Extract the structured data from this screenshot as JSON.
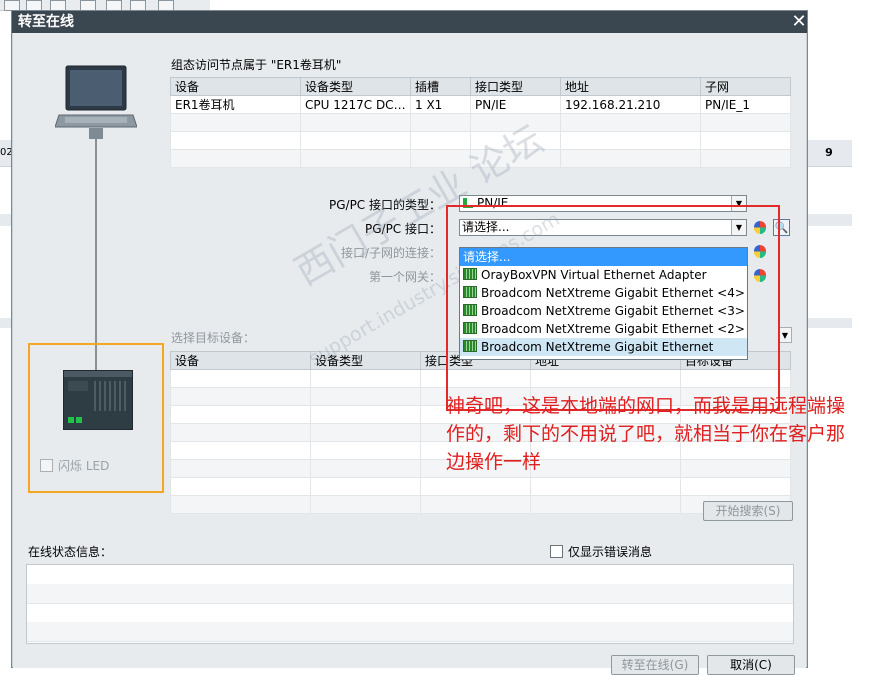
{
  "dialog": {
    "title": "转至在线",
    "close_label": "✕"
  },
  "background": {
    "cell_value": "9",
    "left_cell_value": "02"
  },
  "group_info": "组态访问节点属于 \"ER1卷耳机\"",
  "device_table": {
    "headers": [
      "设备",
      "设备类型",
      "插槽",
      "接口类型",
      "地址",
      "子网"
    ],
    "rows": [
      [
        "ER1卷耳机",
        "CPU 1217C DC/D...",
        "1 X1",
        "PN/IE",
        "192.168.21.210",
        "PN/IE_1"
      ]
    ]
  },
  "form": {
    "pgpc_type_label": "PG/PC 接口的类型：",
    "pgpc_type_value": "PN/IE",
    "pgpc_iface_label": "PG/PC 接口：",
    "pgpc_iface_value": "请选择...",
    "subnet_conn_label": "接口/子网的连接：",
    "first_gateway_label": "第一个网关："
  },
  "dropdown": {
    "items": [
      "请选择...",
      "OrayBoxVPN Virtual Ethernet Adapter",
      "Broadcom NetXtreme Gigabit Ethernet <4>",
      "Broadcom NetXtreme Gigabit Ethernet <3>",
      "Broadcom NetXtreme Gigabit Ethernet <2>",
      "Broadcom NetXtreme Gigabit Ethernet"
    ],
    "selected_index": 0,
    "hover_index": 5
  },
  "target_section": {
    "label": "选择目标设备：",
    "headers": [
      "设备",
      "设备类型",
      "接口类型",
      "地址",
      "目标设备"
    ]
  },
  "flash_led_label": "闪烁 LED",
  "annotation": "神奇吧，这是本地端的网口，而我是用远程端操作的，剩下的不用说了吧，就相当于你在客户那边操作一样",
  "watermark": {
    "line1": "西门子工业 论坛",
    "line2": "support.industry.siemens.com"
  },
  "buttons": {
    "start_search": "开始搜索(S)",
    "go_online": "转至在线(G)",
    "cancel": "取消(C)"
  },
  "status": {
    "label": "在线状态信息：",
    "errors_only_label": "仅显示错误消息"
  },
  "colors": {
    "title_bar": "#3a4650",
    "highlight_box": "#e32a2a",
    "target_box": "#f5a623",
    "annotation": "#e02020",
    "selection": "#3399ff"
  }
}
